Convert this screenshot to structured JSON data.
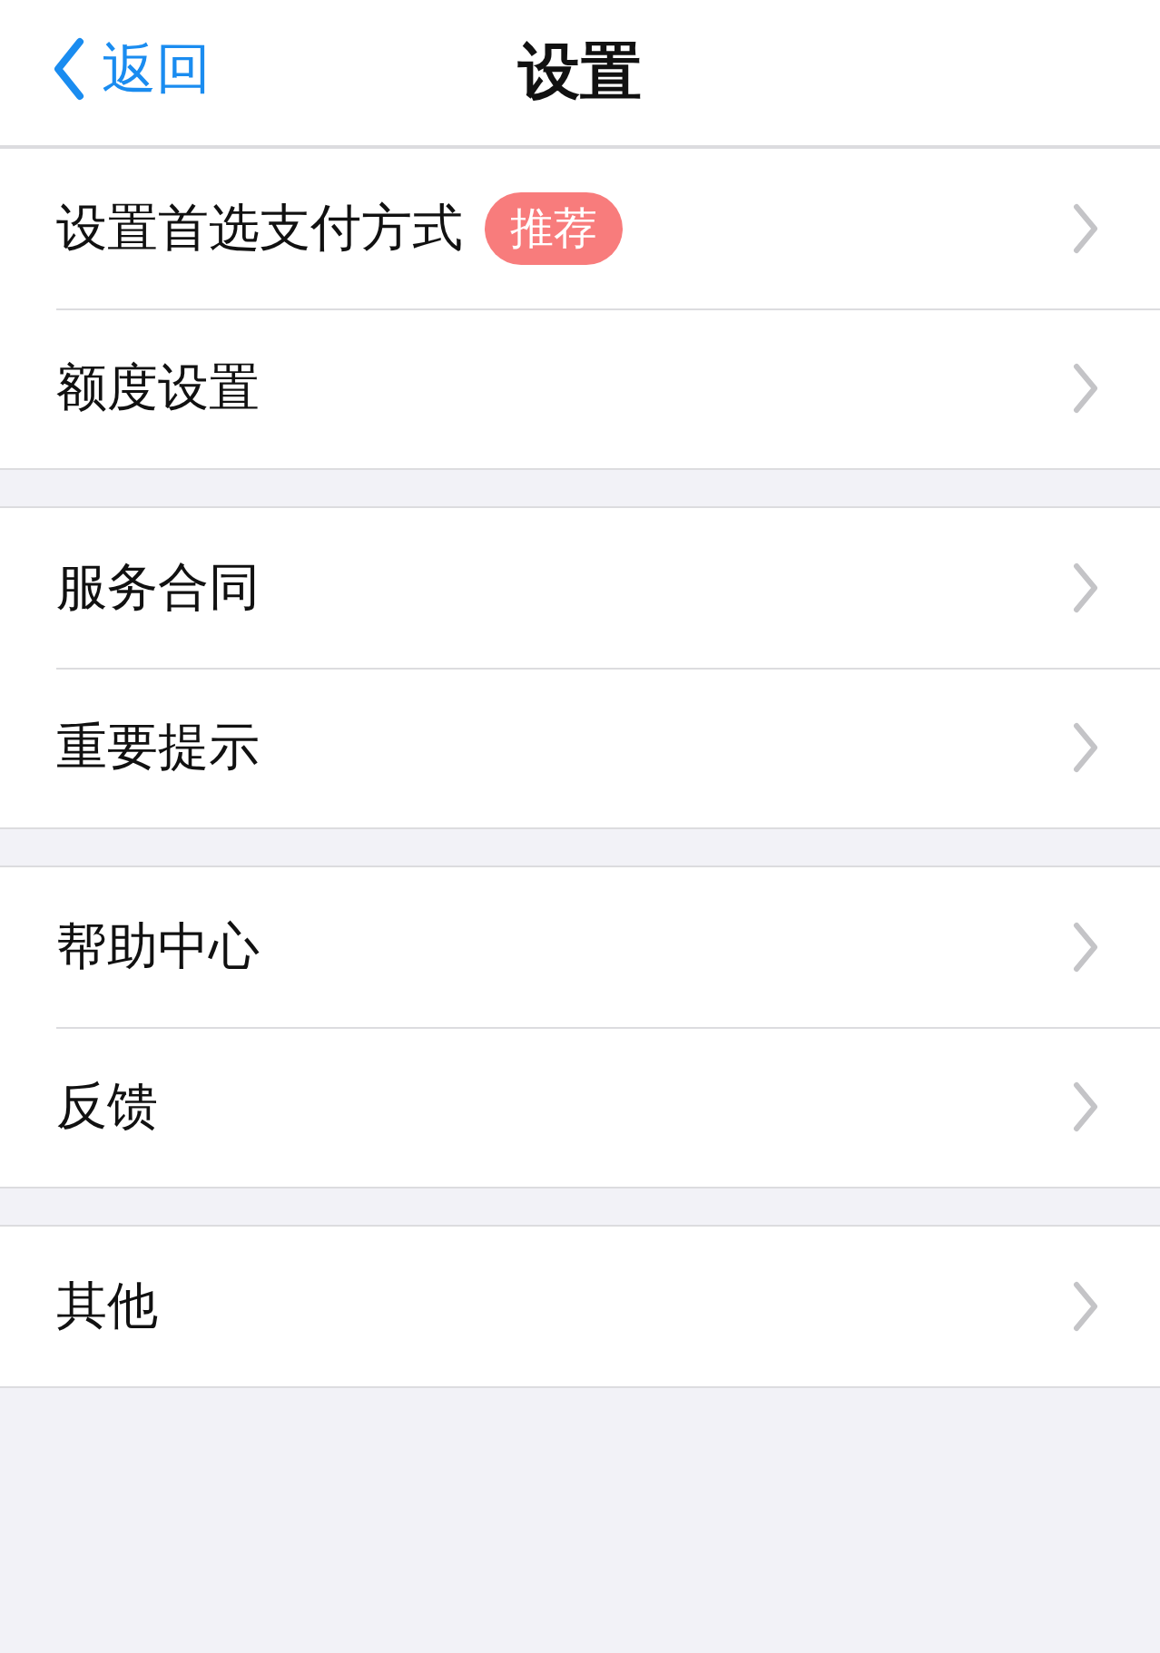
{
  "nav": {
    "back": "返回",
    "title": "设置"
  },
  "groups": [
    {
      "items": [
        {
          "label": "设置首选支付方式",
          "badge": "推荐"
        },
        {
          "label": "额度设置"
        }
      ]
    },
    {
      "items": [
        {
          "label": "服务合同"
        },
        {
          "label": "重要提示"
        }
      ]
    },
    {
      "items": [
        {
          "label": "帮助中心"
        },
        {
          "label": "反馈"
        }
      ]
    },
    {
      "items": [
        {
          "label": "其他"
        }
      ]
    }
  ]
}
